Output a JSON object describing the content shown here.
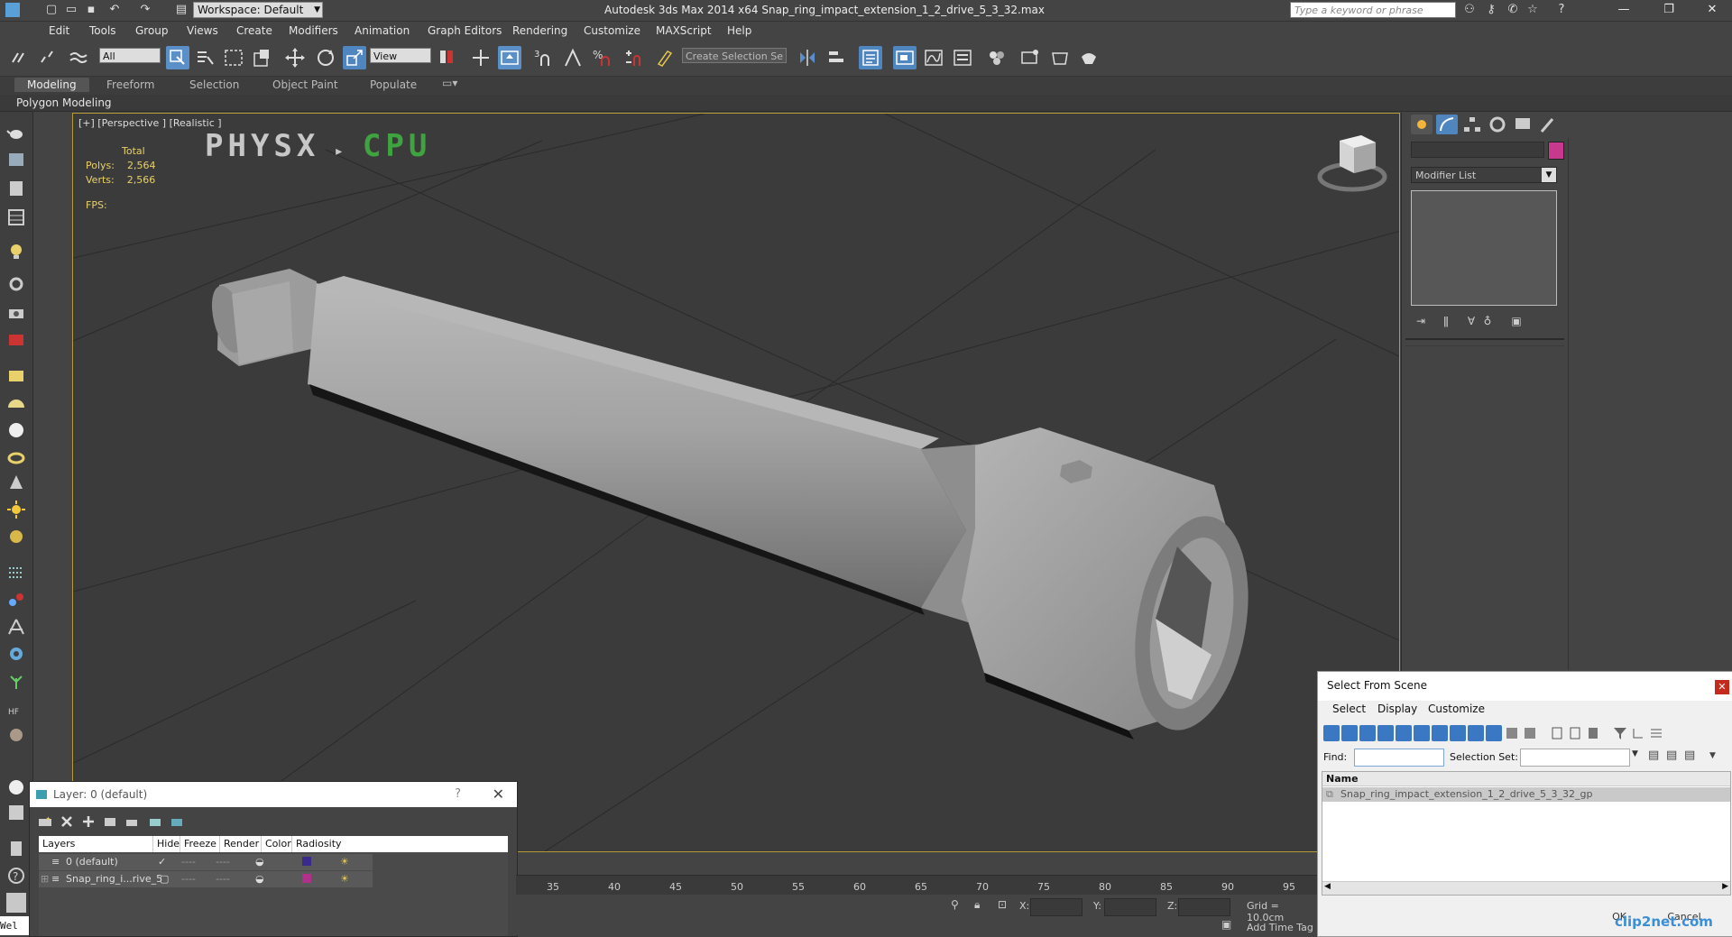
{
  "titlebar": {
    "workspace": "Workspace: Default",
    "title": "Autodesk 3ds Max  2014 x64      Snap_ring_impact_extension_1_2_drive_5_3_32.max",
    "search_placeholder": "Type a keyword or phrase"
  },
  "menu": [
    "Edit",
    "Tools",
    "Group",
    "Views",
    "Create",
    "Modifiers",
    "Animation",
    "Graph Editors",
    "Rendering",
    "Customize",
    "MAXScript",
    "Help"
  ],
  "toolbar": {
    "filter": "All",
    "ref_coord": "View",
    "named_selection": "Create Selection Se"
  },
  "ribbon": {
    "tabs": [
      "Modeling",
      "Freeform",
      "Selection",
      "Object Paint",
      "Populate"
    ],
    "panel_label": "Polygon Modeling"
  },
  "viewport": {
    "label": "[+] [Perspective ] [Realistic ]",
    "stats_header": "Total",
    "polys_label": "Polys:",
    "polys_value": "2,564",
    "verts_label": "Verts:",
    "verts_value": "2,566",
    "fps_label": "FPS:",
    "physx_left": "PHYSX",
    "physx_right": "CPU"
  },
  "command_panel": {
    "modifier_list": "Modifier List",
    "swatch_color": "#c8388c"
  },
  "select_from_scene": {
    "title": "Select From Scene",
    "menu": [
      "Select",
      "Display",
      "Customize"
    ],
    "find_label": "Find:",
    "selection_set_label": "Selection Set:",
    "column_name": "Name",
    "items": [
      "Snap_ring_impact_extension_1_2_drive_5_3_32_gp"
    ],
    "ok": "OK",
    "cancel": "Cancel"
  },
  "layer_dialog": {
    "title": "Layer: 0 (default)",
    "columns": [
      "Layers",
      "Hide",
      "Freeze",
      "Render",
      "Color",
      "Radiosity"
    ],
    "rows": [
      {
        "name": "0 (default)",
        "color": "#3a2a8c"
      },
      {
        "name": "Snap_ring_i...rive_5",
        "color": "#b0308c"
      }
    ]
  },
  "timeline": {
    "ticks": [
      "35",
      "40",
      "45",
      "50",
      "55",
      "60",
      "65",
      "70",
      "75",
      "80",
      "85",
      "90",
      "95"
    ]
  },
  "status": {
    "x_label": "X:",
    "y_label": "Y:",
    "z_label": "Z:",
    "grid": "Grid = 10.0cm",
    "add_time_tag": "Add Time Tag",
    "listener": "Wel"
  },
  "watermark": "clip2net.com"
}
